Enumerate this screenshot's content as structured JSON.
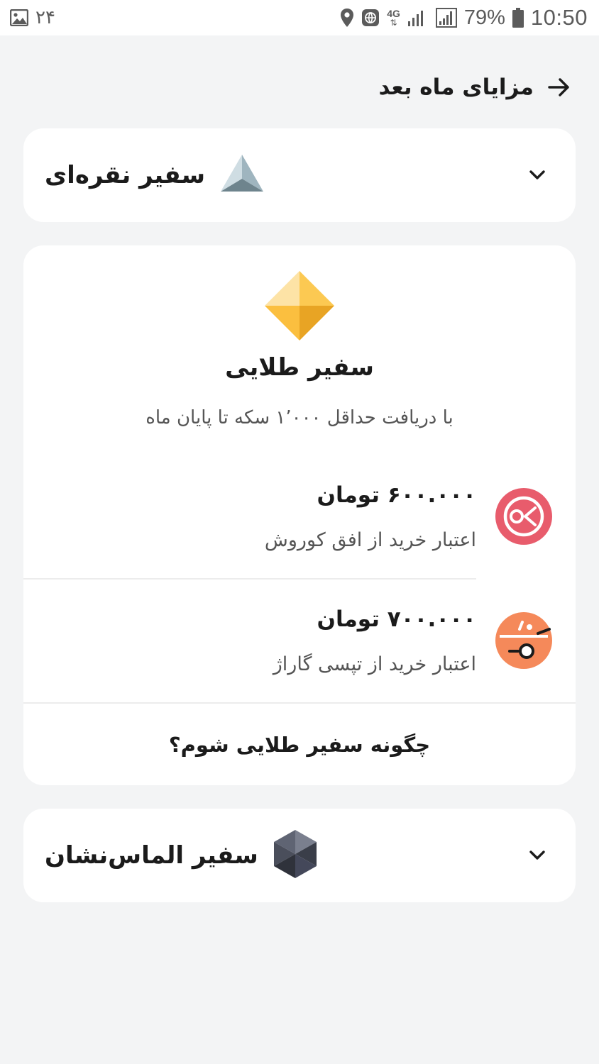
{
  "status_bar": {
    "notification_count": "۲۴",
    "network": "4G",
    "battery": "79%",
    "time": "10:50"
  },
  "header": {
    "title": "مزایای ماه بعد"
  },
  "tiers": {
    "silver": {
      "name": "سفیر نقره‌ای",
      "icon": "silver-pyramid-icon"
    },
    "gold": {
      "name": "سفیر طلایی",
      "subtitle": "با دریافت حداقل ۱٬۰۰۰ سکه تا پایان ماه",
      "icon": "gold-diamond-icon",
      "benefits": [
        {
          "amount": "۶۰۰.۰۰۰ تومان",
          "description": "اعتبار خرید از افق کوروش",
          "logo": "ofoq-kourosh-logo",
          "color": "#e85c6c"
        },
        {
          "amount": "۷۰۰.۰۰۰ تومان",
          "description": "اعتبار خرید از تپسی گاراژ",
          "logo": "tapsi-garage-logo",
          "color": "#f5895a"
        }
      ],
      "how_link": "چگونه سفیر طلایی شوم؟"
    },
    "diamond": {
      "name": "سفیر الماس‌نشان",
      "icon": "diamond-hexagon-icon"
    }
  }
}
